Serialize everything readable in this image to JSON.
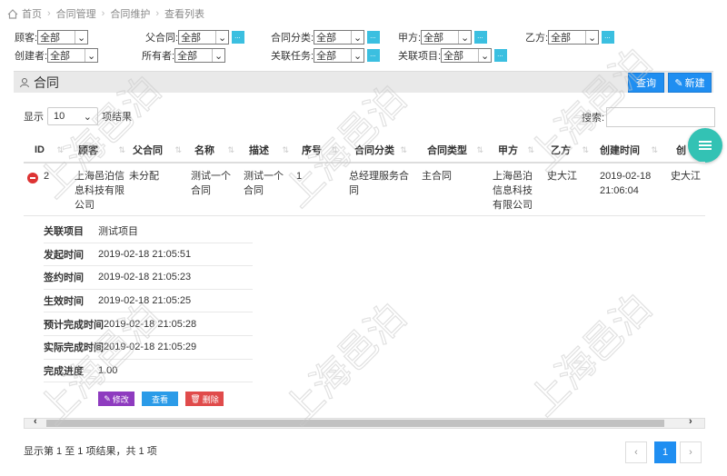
{
  "breadcrumb": [
    "首页",
    "合同管理",
    "合同维护",
    "查看列表"
  ],
  "filters": {
    "customer_label": "顾客:",
    "customer_value": "全部",
    "parent_label": "父合同:",
    "parent_value": "全部",
    "category_label": "合同分类:",
    "category_value": "全部",
    "party_a_label": "甲方:",
    "party_a_value": "全部",
    "party_b_label": "乙方:",
    "party_b_value": "全部",
    "creator_label": "创建者:",
    "creator_value": "全部",
    "owner_label": "所有者:",
    "owner_value": "全部",
    "task_label": "关联任务:",
    "task_value": "全部",
    "project_label": "关联项目:",
    "project_value": "全部"
  },
  "panel": {
    "title": "合同",
    "query_button": "查询",
    "new_button": "新建"
  },
  "length": {
    "prefix": "显示",
    "value": "10",
    "suffix": "项结果"
  },
  "search": {
    "label": "搜索:"
  },
  "table": {
    "headers": [
      "ID",
      "顾客",
      "父合同",
      "名称",
      "描述",
      "序号",
      "合同分类",
      "合同类型",
      "甲方",
      "乙方",
      "创建时间",
      "创"
    ],
    "row": {
      "id": "2",
      "customer": "上海邑泊信息科技有限公司",
      "parent": "未分配",
      "name": "测试一个合同",
      "desc": "测试一个合同",
      "seq": "1",
      "category": "总经理服务合同",
      "type": "主合同",
      "party_a": "上海邑泊信息科技有限公司",
      "party_b": "史大江",
      "created": "2019-02-18 21:06:04",
      "creator": "史大江"
    }
  },
  "detail": [
    {
      "label": "关联项目",
      "value": "测试项目"
    },
    {
      "label": "发起时间",
      "value": "2019-02-18 21:05:51"
    },
    {
      "label": "签约时间",
      "value": "2019-02-18 21:05:23"
    },
    {
      "label": "生效时间",
      "value": "2019-02-18 21:05:25"
    },
    {
      "label": "预计完成时间",
      "value": "2019-02-18 21:05:28"
    },
    {
      "label": "实际完成时间",
      "value": "2019-02-18 21:05:29"
    },
    {
      "label": "完成进度",
      "value": "1.00"
    }
  ],
  "actions": {
    "edit": "修改",
    "view": "查看",
    "delete": "删除"
  },
  "info": "显示第 1 至 1 项结果，共 1 项",
  "pager": {
    "prev": "‹",
    "current": "1",
    "next": "›"
  },
  "watermark": "上海邑泊",
  "colors": {
    "primary": "#1f8ef1",
    "teal": "#33c2b4",
    "edit": "#8e3bbf",
    "view": "#2b9be8",
    "delete": "#e04b4b"
  }
}
